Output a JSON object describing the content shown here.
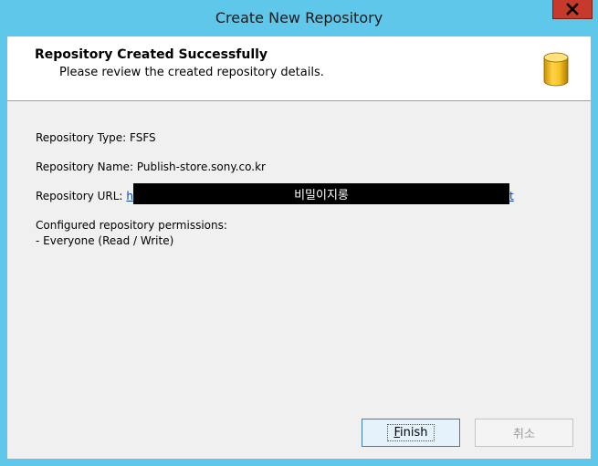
{
  "window": {
    "title": "Create New Repository"
  },
  "header": {
    "title": "Repository Created Successfully",
    "subtitle": "Please review the created repository details.",
    "icon": "database-icon"
  },
  "details": {
    "type_label": "Repository Type: FSFS",
    "name_label": "Repository Name: Publish-store.sony.co.kr",
    "url_label": "Repository URL:",
    "url_visible_start": "h",
    "url_redaction_text": "비밀이지롱",
    "url_visible_end": "t",
    "permissions_heading": "Configured repository permissions:",
    "permissions_value": "- Everyone (Read / Write)"
  },
  "buttons": {
    "finish_first": "F",
    "finish_rest": "inish",
    "cancel": "취소"
  },
  "colors": {
    "title_bar": "#5ec7ea",
    "close_button": "#c7392b",
    "link": "#0645ad"
  }
}
